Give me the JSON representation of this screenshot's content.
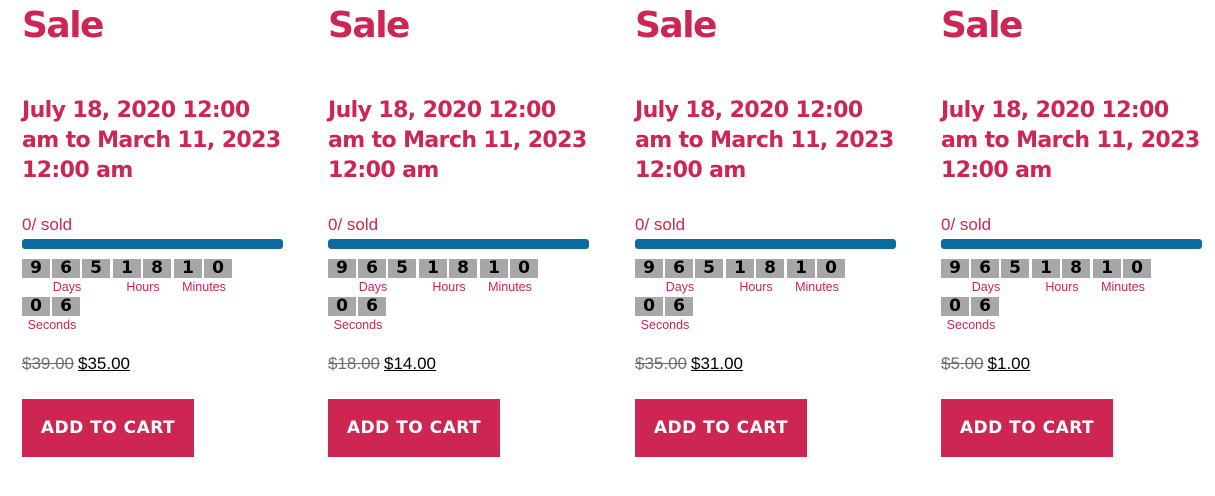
{
  "colors": {
    "accent": "#cd2653",
    "progress_bar": "#0e6ba0",
    "digit_background": "#a7a7a7",
    "old_price": "#6d6d6d"
  },
  "products": [
    {
      "badge": "Sale",
      "date_range": "July 18, 2020 12:00 am to March 11, 2023 12:00 am",
      "sold_text": "0/ sold",
      "sold_fraction": 0,
      "countdown": {
        "days": [
          "9",
          "6",
          "5"
        ],
        "hours": [
          "1",
          "8"
        ],
        "minutes": [
          "1",
          "0"
        ],
        "seconds": [
          "0",
          "6"
        ],
        "labels": {
          "days": "Days",
          "hours": "Hours",
          "minutes": "Minutes",
          "seconds": "Seconds"
        }
      },
      "old_price": "$39.00",
      "new_price": "$35.00",
      "button_label": "ADD TO CART"
    },
    {
      "badge": "Sale",
      "date_range": "July 18, 2020 12:00 am to March 11, 2023 12:00 am",
      "sold_text": "0/ sold",
      "sold_fraction": 0,
      "countdown": {
        "days": [
          "9",
          "6",
          "5"
        ],
        "hours": [
          "1",
          "8"
        ],
        "minutes": [
          "1",
          "0"
        ],
        "seconds": [
          "0",
          "6"
        ],
        "labels": {
          "days": "Days",
          "hours": "Hours",
          "minutes": "Minutes",
          "seconds": "Seconds"
        }
      },
      "old_price": "$18.00",
      "new_price": "$14.00",
      "button_label": "ADD TO CART"
    },
    {
      "badge": "Sale",
      "date_range": "July 18, 2020 12:00 am to March 11, 2023 12:00 am",
      "sold_text": "0/ sold",
      "sold_fraction": 0,
      "countdown": {
        "days": [
          "9",
          "6",
          "5"
        ],
        "hours": [
          "1",
          "8"
        ],
        "minutes": [
          "1",
          "0"
        ],
        "seconds": [
          "0",
          "6"
        ],
        "labels": {
          "days": "Days",
          "hours": "Hours",
          "minutes": "Minutes",
          "seconds": "Seconds"
        }
      },
      "old_price": "$35.00",
      "new_price": "$31.00",
      "button_label": "ADD TO CART"
    },
    {
      "badge": "Sale",
      "date_range": "July 18, 2020 12:00 am to March 11, 2023 12:00 am",
      "sold_text": "0/ sold",
      "sold_fraction": 0,
      "countdown": {
        "days": [
          "9",
          "6",
          "5"
        ],
        "hours": [
          "1",
          "8"
        ],
        "minutes": [
          "1",
          "0"
        ],
        "seconds": [
          "0",
          "6"
        ],
        "labels": {
          "days": "Days",
          "hours": "Hours",
          "minutes": "Minutes",
          "seconds": "Seconds"
        }
      },
      "old_price": "$5.00",
      "new_price": "$1.00",
      "button_label": "ADD TO CART"
    }
  ]
}
